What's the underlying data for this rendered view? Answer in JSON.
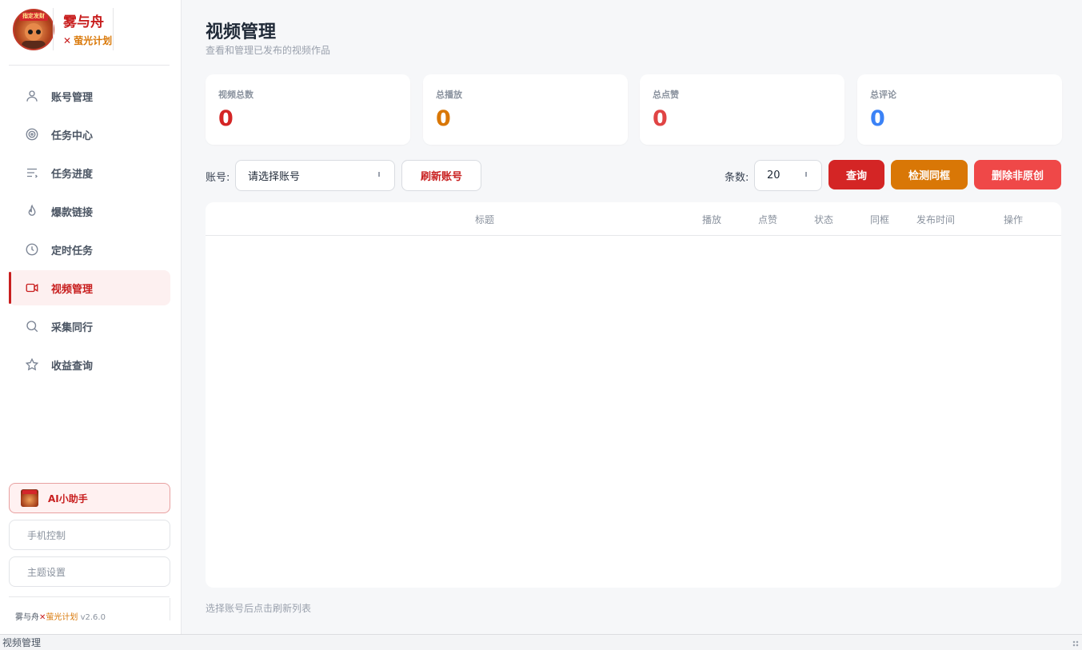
{
  "brand": {
    "logo_banner": "指定发财",
    "name": "雾与舟",
    "sub_x": "✕",
    "sub_name": "萤光计划"
  },
  "sidebar": {
    "items": [
      {
        "label": "账号管理",
        "icon": "user-icon"
      },
      {
        "label": "任务中心",
        "icon": "target-icon"
      },
      {
        "label": "任务进度",
        "icon": "progress-lines-icon"
      },
      {
        "label": "爆款链接",
        "icon": "flame-icon"
      },
      {
        "label": "定时任务",
        "icon": "clock-icon"
      },
      {
        "label": "视频管理",
        "icon": "video-camera-icon",
        "active": true
      },
      {
        "label": "采集同行",
        "icon": "search-icon"
      },
      {
        "label": "收益查询",
        "icon": "star-icon"
      }
    ],
    "ai_assistant": "AI小助手",
    "phone_control": "手机控制",
    "theme_settings": "主题设置",
    "footer": {
      "name": "雾与舟",
      "x": "✕",
      "project": "萤光计划",
      "version": " v2.6.0"
    }
  },
  "main": {
    "title": "视频管理",
    "subtitle": "查看和管理已发布的视频作品",
    "stats": [
      {
        "label": "视频总数",
        "value": "0",
        "color": "#d42525"
      },
      {
        "label": "总播放",
        "value": "0",
        "color": "#d97706"
      },
      {
        "label": "总点赞",
        "value": "0",
        "color": "#e04444"
      },
      {
        "label": "总评论",
        "value": "0",
        "color": "#3b82f6"
      }
    ],
    "toolbar": {
      "account_label": "账号:",
      "account_placeholder": "请选择账号",
      "refresh_label": "刷新账号",
      "count_label": "条数:",
      "count_value": "20",
      "query_label": "查询",
      "detect_label": "检测同框",
      "delete_label": "删除非原创"
    },
    "table": {
      "columns": [
        "标题",
        "播放",
        "点赞",
        "状态",
        "同框",
        "发布时间",
        "操作"
      ],
      "rows": []
    },
    "hint": "选择账号后点击刷新列表"
  },
  "statusbar": {
    "text": "视频管理"
  },
  "colors": {
    "accent": "#c81e1e",
    "orange": "#d97706",
    "danger": "#ef4848",
    "blue": "#3b82f6"
  }
}
